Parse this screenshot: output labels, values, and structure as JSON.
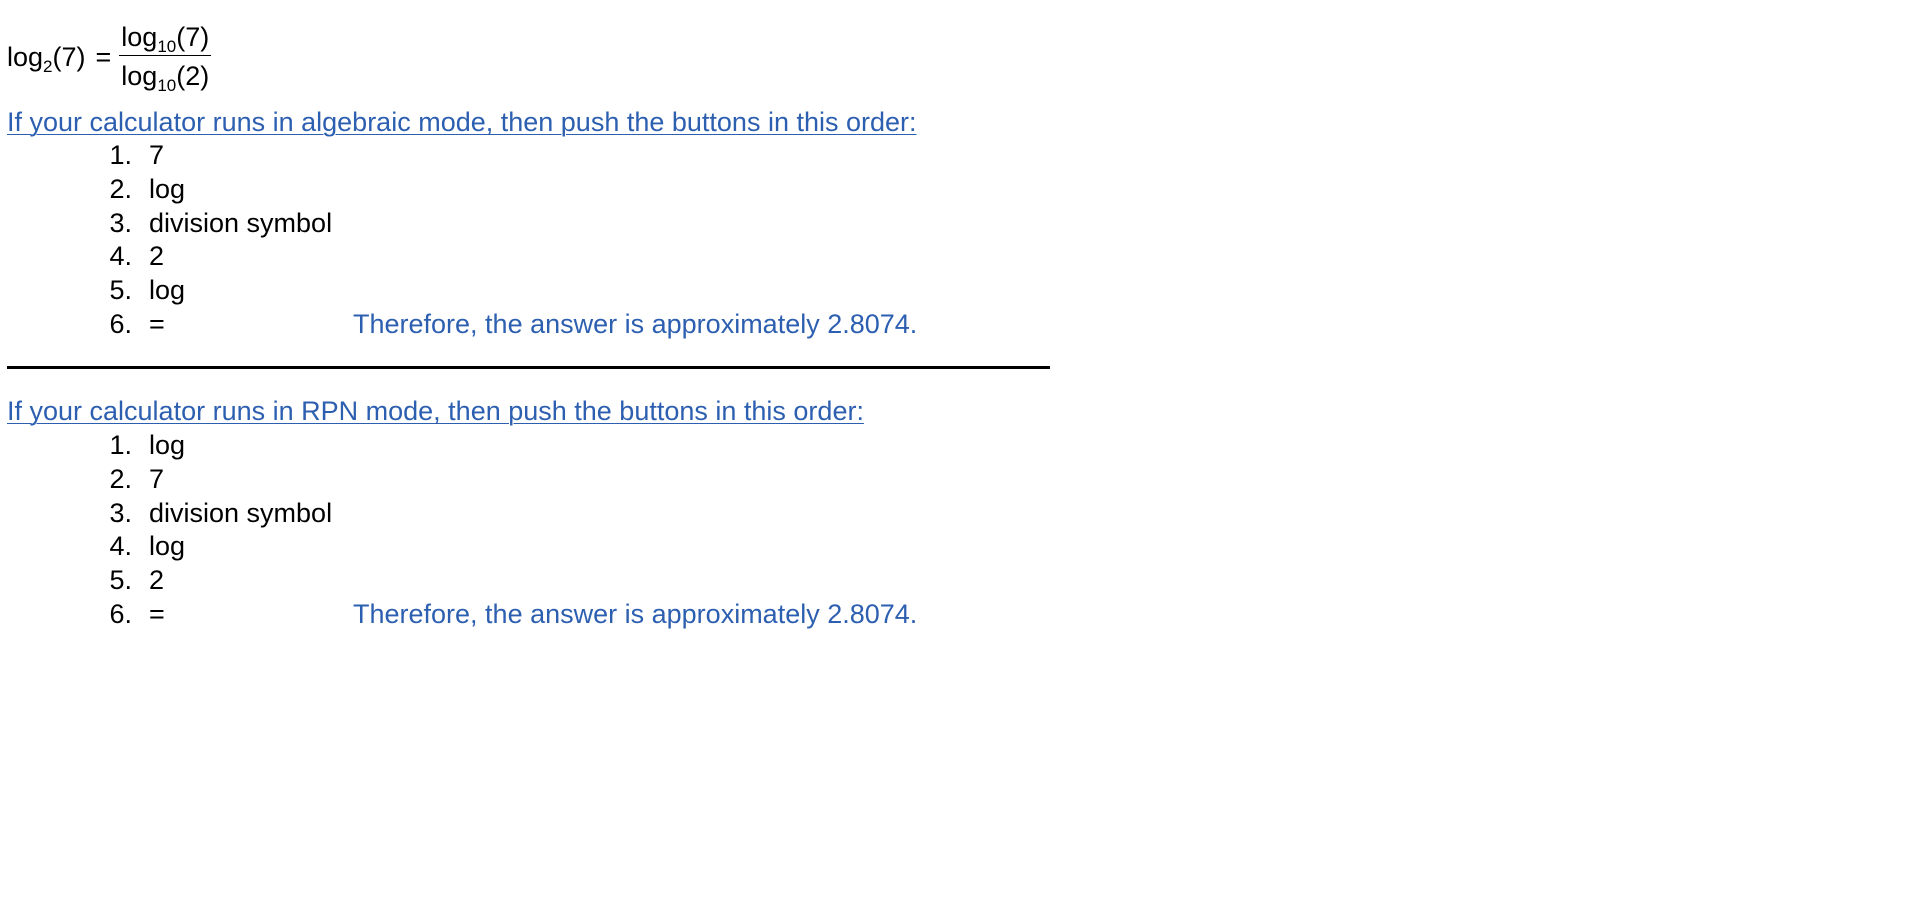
{
  "formula": {
    "lhs_fn": "log",
    "lhs_base": "2",
    "lhs_arg": "(7)",
    "equals": "=",
    "num_fn": "log",
    "num_base": "10",
    "num_arg": "(7)",
    "den_fn": "log",
    "den_base": "10",
    "den_arg": "(2)"
  },
  "algebraic": {
    "heading": "If your calculator runs in algebraic mode, then push the buttons in this order:",
    "steps": [
      {
        "num": "1.",
        "text": "7"
      },
      {
        "num": "2.",
        "text": "log"
      },
      {
        "num": "3.",
        "text": "division symbol"
      },
      {
        "num": "4.",
        "text": "2"
      },
      {
        "num": "5.",
        "text": "log"
      },
      {
        "num": "6.",
        "text": "="
      }
    ],
    "answer": "Therefore, the answer is approximately 2.8074."
  },
  "rpn": {
    "heading": "If your calculator runs in RPN mode, then push the buttons in this order:",
    "steps": [
      {
        "num": "1.",
        "text": "log"
      },
      {
        "num": "2.",
        "text": "7"
      },
      {
        "num": "3.",
        "text": "division symbol"
      },
      {
        "num": "4.",
        "text": "log"
      },
      {
        "num": "5.",
        "text": "2"
      },
      {
        "num": "6.",
        "text": "="
      }
    ],
    "answer": "Therefore, the answer is approximately 2.8074."
  },
  "colors": {
    "link_blue": "#2d5fb0",
    "text": "#000000",
    "background": "#ffffff"
  }
}
